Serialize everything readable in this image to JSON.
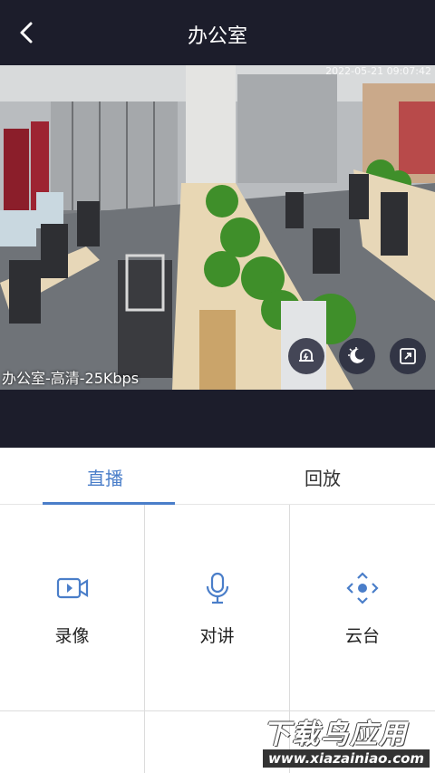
{
  "header": {
    "title": "办公室"
  },
  "video": {
    "timestamp": "2022-05-21 09:07:42",
    "camera_label": "办公室-高清-25Kbps"
  },
  "tabs": [
    {
      "label": "直播",
      "active": true
    },
    {
      "label": "回放",
      "active": false
    }
  ],
  "functions": [
    {
      "label": "录像",
      "icon": "record-video-icon"
    },
    {
      "label": "对讲",
      "icon": "microphone-icon"
    },
    {
      "label": "云台",
      "icon": "ptz-direction-icon"
    }
  ],
  "watermark": {
    "title": "下载鸟应用",
    "url": "www.xiazainiao.com"
  },
  "colors": {
    "header_bg": "#1c1d2b",
    "accent": "#4a7ec9"
  }
}
